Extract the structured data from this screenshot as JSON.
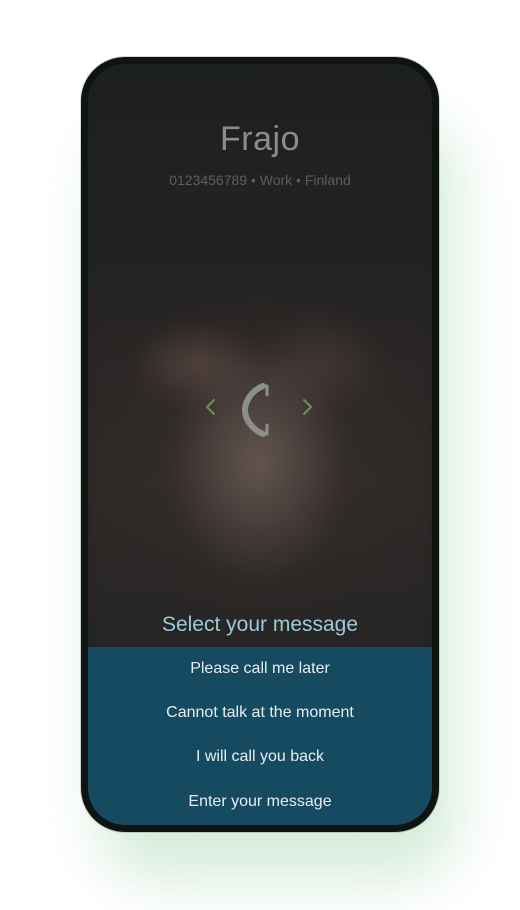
{
  "caller": {
    "name": "Frajo",
    "details": "0123456789 • Work • Finland"
  },
  "controls": {
    "left_arrow_icon": "chevron-left",
    "right_arrow_icon": "chevron-right",
    "center_icon": "phone-handset",
    "arrow_color": "#6f8f56",
    "handset_color": "#8d8f8d"
  },
  "messages": {
    "title": "Select your message",
    "items": [
      "Please call me later",
      "Cannot talk at the moment",
      "I will call you back",
      "Enter your message"
    ]
  },
  "colors": {
    "panel": "#144e66",
    "title": "#9fc9da",
    "background": "#262827"
  }
}
